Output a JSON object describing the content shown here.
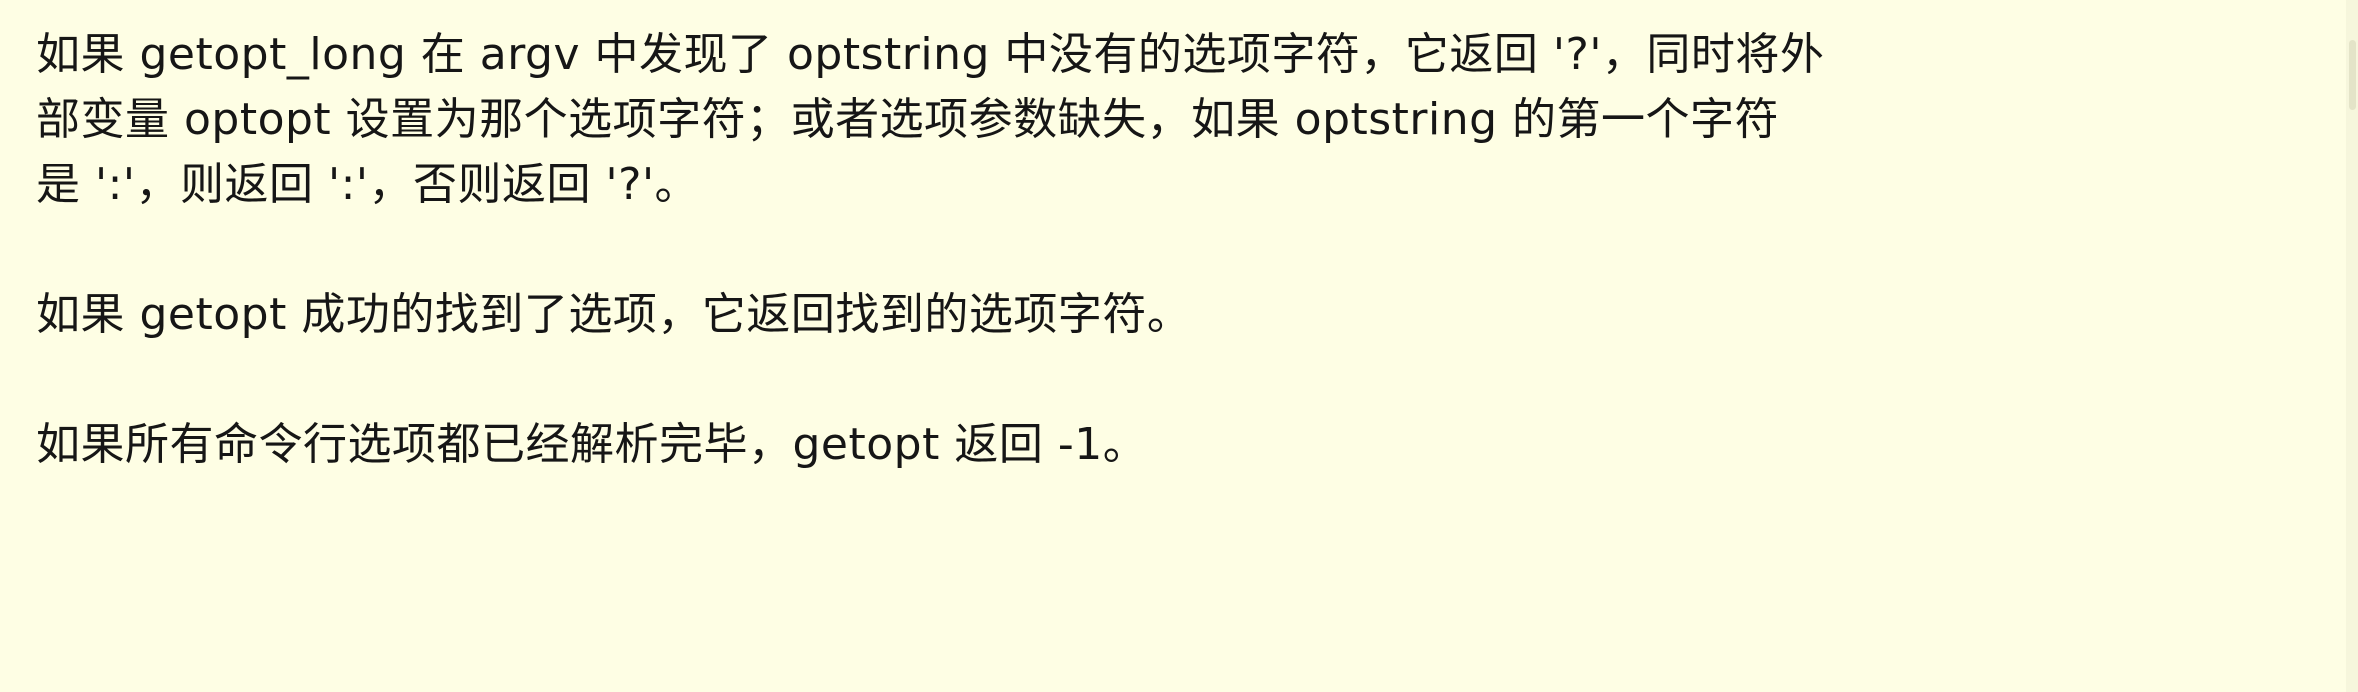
{
  "document": {
    "paragraphs": [
      {
        "lines": [
          "如果 getopt_long 在 argv 中发现了 optstring 中没有的选项字符，它返回 '?'，同时将外",
          "部变量 optopt 设置为那个选项字符；或者选项参数缺失，如果 optstring 的第一个字符",
          "是 ':'，则返回 ':'，否则返回 '?'。"
        ]
      },
      {
        "lines": [
          "如果 getopt 成功的找到了选项，它返回找到的选项字符。"
        ]
      },
      {
        "lines": [
          "如果所有命令行选项都已经解析完毕，getopt 返回 -1。"
        ]
      }
    ]
  },
  "colors": {
    "background": "#fefee4",
    "text": "#161616"
  }
}
